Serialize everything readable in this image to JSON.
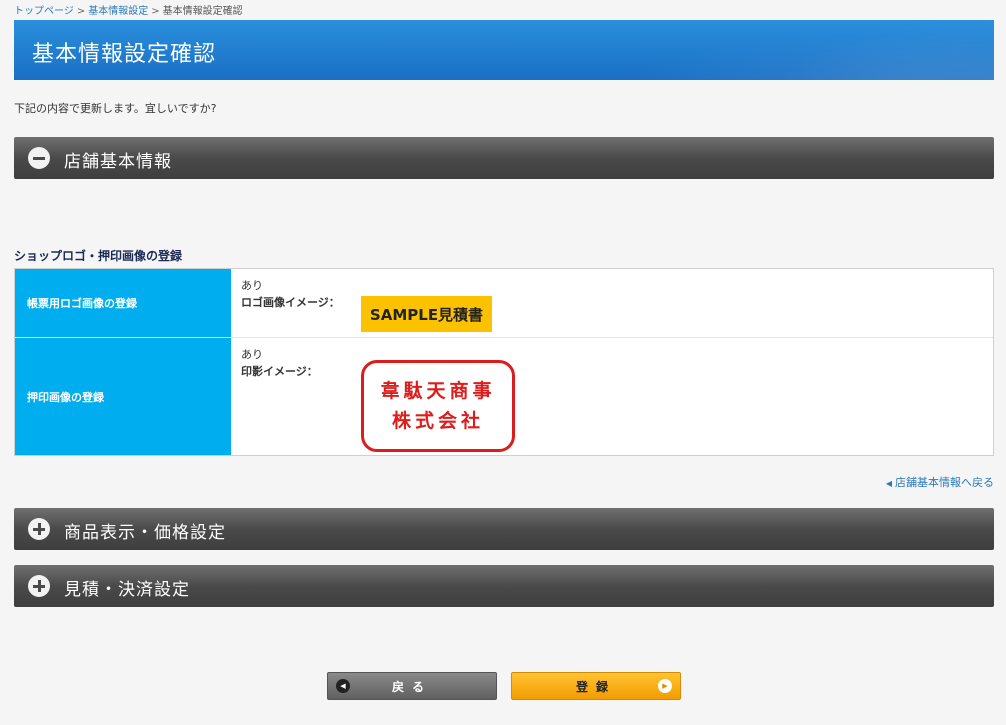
{
  "breadcrumb": {
    "home": "トップページ",
    "settings": "基本情報設定",
    "current": "基本情報設定確認",
    "separator": ">"
  },
  "page": {
    "title": "基本情報設定確認",
    "intro": "下記の内容で更新します。宜しいですか?"
  },
  "sections": {
    "store_info": "店舗基本情報",
    "product_display": "商品表示・価格設定",
    "estimate_payment": "見積・決済設定"
  },
  "logo_section": {
    "title": "ショップロゴ・押印画像の登録",
    "rows": [
      {
        "header": "帳票用ロゴ画像の登録",
        "value": "あり",
        "label": "ロゴ画像イメージ：",
        "image_text": "SAMPLE見積書"
      },
      {
        "header": "押印画像の登録",
        "value": "あり",
        "label": "印影イメージ：",
        "stamp_line1": "韋駄天商事",
        "stamp_line2": "株式会社"
      }
    ]
  },
  "back_link": "店舗基本情報へ戻る",
  "buttons": {
    "back": "戻る",
    "submit": "登録"
  },
  "colors": {
    "title_bar": "#1a78cf",
    "table_header": "#00aef0",
    "accordion": "#4a4a4a",
    "logo_bg": "#fcc200",
    "stamp": "#dd1c1c",
    "submit_button": "#f29b00"
  },
  "icons": {
    "collapse": "minus-circle-icon",
    "expand": "plus-circle-icon",
    "back_arrow": "left-triangle-icon",
    "submit_arrow": "right-triangle-icon"
  }
}
